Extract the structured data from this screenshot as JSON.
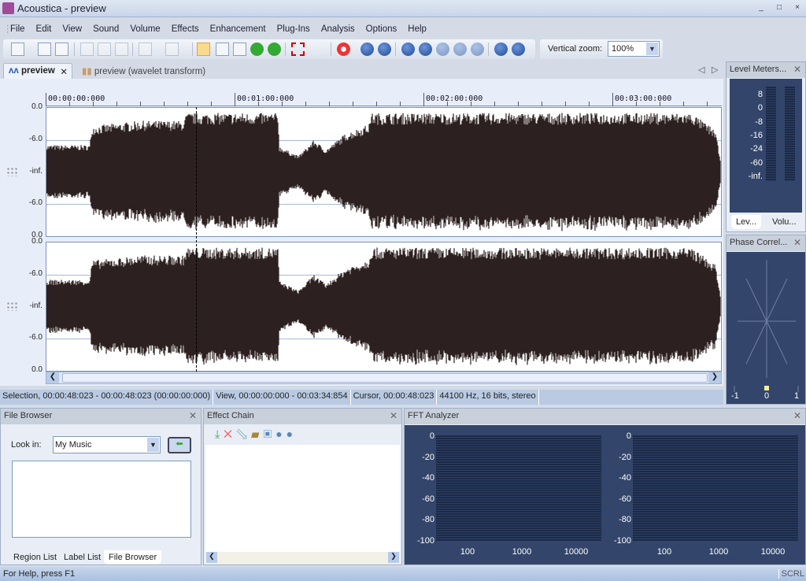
{
  "window": {
    "title": "Acoustica - preview",
    "controls": [
      "_",
      "□",
      "×"
    ]
  },
  "menu": [
    "File",
    "Edit",
    "View",
    "Sound",
    "Volume",
    "Effects",
    "Enhancement",
    "Plug-Ins",
    "Analysis",
    "Options",
    "Help"
  ],
  "toolbar": {
    "icons": [
      "new-icon",
      "open-icon",
      "save-icon",
      "cut-icon",
      "copy-icon",
      "paste-icon",
      "undo-icon",
      "redo-icon",
      "select-icon",
      "zoom-icon",
      "scrub-icon",
      "back-icon",
      "loop-icon",
      "grid-icon",
      "record-icon",
      "go-start-icon",
      "rewind-icon",
      "play-icon",
      "play-selection-icon",
      "loop-play-icon",
      "stop-icon",
      "pause-icon",
      "forward-icon",
      "go-end-icon"
    ],
    "vertical_zoom_label": "Vertical zoom:",
    "vertical_zoom_value": "100%"
  },
  "tabs": [
    {
      "label": "preview",
      "active": true
    },
    {
      "label": "preview (wavelet transform)",
      "active": false
    }
  ],
  "ruler": [
    "00:00:00:000",
    "00:01:00:000",
    "00:02:00:000",
    "00:03:00:000"
  ],
  "channel_axis": [
    "0.0",
    "-6.0",
    "-inf.",
    "-6.0",
    "0.0"
  ],
  "status": {
    "selection": "Selection, 00:00:48:023 - 00:00:48:023 (00:00:00:000)",
    "view": "View, 00:00:00:000 - 00:03:34:854",
    "cursor": "Cursor, 00:00:48:023",
    "format": "44100 Hz, 16 bits, stereo"
  },
  "level_meters": {
    "title": "Level Meters...",
    "scale": [
      "8",
      "0",
      "-8",
      "-16",
      "-24",
      "-60",
      "-inf."
    ],
    "tabs": [
      "Lev...",
      "Volu..."
    ]
  },
  "phase": {
    "title": "Phase Correl...",
    "scale": [
      "-1",
      "0",
      "1"
    ]
  },
  "file_browser": {
    "title": "File Browser",
    "look_in_label": "Look in:",
    "look_in_value": "My Music",
    "tabs": [
      "Region List",
      "Label List",
      "File Browser"
    ]
  },
  "effect_chain": {
    "title": "Effect Chain"
  },
  "fft": {
    "title": "FFT Analyzer",
    "y": [
      "0",
      "-20",
      "-40",
      "-60",
      "-80",
      "-100"
    ],
    "x": [
      "100",
      "1000",
      "10000"
    ]
  },
  "helpbar": {
    "text": "For Help, press F1",
    "scrl": "SCRL"
  },
  "colors": {
    "waveform": "#2d2020",
    "panel_dark": "#33456a",
    "accent": "#1d4a9c"
  }
}
